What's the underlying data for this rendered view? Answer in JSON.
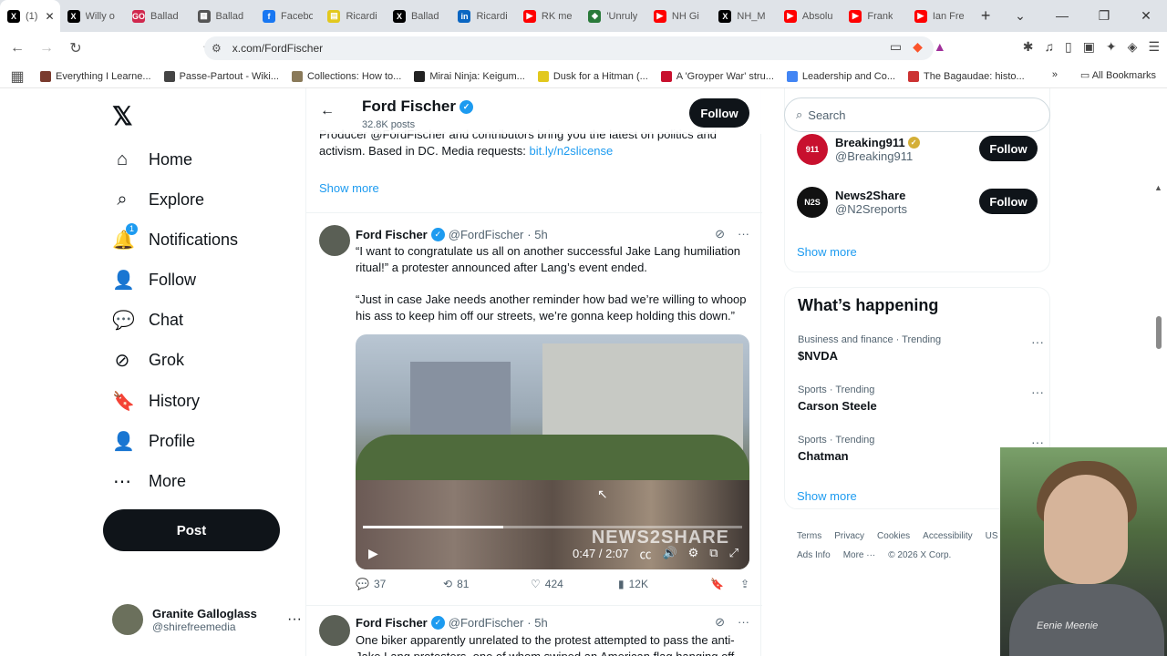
{
  "browser": {
    "tabs": [
      {
        "label": "(1)",
        "favicon": "X",
        "color": "#000000",
        "active": true
      },
      {
        "label": "Willy o",
        "favicon": "X",
        "color": "#000000"
      },
      {
        "label": "Ballad",
        "favicon": "GO",
        "color": "#d0284e"
      },
      {
        "label": "Ballad",
        "favicon": "▦",
        "color": "#555555"
      },
      {
        "label": "Facebo",
        "favicon": "f",
        "color": "#1877f2"
      },
      {
        "label": "Ricardi",
        "favicon": "▤",
        "color": "#e2c81e"
      },
      {
        "label": "Ballad",
        "favicon": "X",
        "color": "#000000"
      },
      {
        "label": "Ricardi",
        "favicon": "in",
        "color": "#0a66c2"
      },
      {
        "label": "RK me",
        "favicon": "▶",
        "color": "#ff0000"
      },
      {
        "label": "'Unruly",
        "favicon": "◆",
        "color": "#2a7a3a"
      },
      {
        "label": "NH Gi",
        "favicon": "▶",
        "color": "#ff0000"
      },
      {
        "label": "NH_M",
        "favicon": "X",
        "color": "#000000"
      },
      {
        "label": "Absolu",
        "favicon": "▶",
        "color": "#ff0000"
      },
      {
        "label": "Frank",
        "favicon": "▶",
        "color": "#ff0000"
      },
      {
        "label": "Ian Fre",
        "favicon": "▶",
        "color": "#ff0000"
      }
    ],
    "url": "x.com/FordFischer",
    "bookmarks": [
      {
        "label": "Everything I Learne...",
        "color": "#7a3b2e"
      },
      {
        "label": "Passe-Partout - Wiki...",
        "color": "#444444"
      },
      {
        "label": "Collections: How to...",
        "color": "#8a7a5a"
      },
      {
        "label": "Mirai Ninja: Keigum...",
        "color": "#222222"
      },
      {
        "label": "Dusk for a Hitman (...",
        "color": "#e2c81e"
      },
      {
        "label": "A 'Groyper War' stru...",
        "color": "#c8102e"
      },
      {
        "label": "Leadership and Co...",
        "color": "#4285f4"
      },
      {
        "label": "The Bagaudae: histo...",
        "color": "#cc3333"
      }
    ],
    "all_bookmarks": "All Bookmarks"
  },
  "nav": {
    "items": [
      {
        "label": "Home",
        "icon": "home-icon",
        "glyph": "⌂"
      },
      {
        "label": "Explore",
        "icon": "search-icon",
        "glyph": "⌕"
      },
      {
        "label": "Notifications",
        "icon": "bell-icon",
        "glyph": "🔔",
        "badge": "1"
      },
      {
        "label": "Follow",
        "icon": "person-plus-icon",
        "glyph": "👤"
      },
      {
        "label": "Chat",
        "icon": "chat-icon",
        "glyph": "💬"
      },
      {
        "label": "Grok",
        "icon": "grok-icon",
        "glyph": "⊘"
      },
      {
        "label": "History",
        "icon": "bookmark-icon",
        "glyph": "🔖"
      },
      {
        "label": "Profile",
        "icon": "profile-icon",
        "glyph": "👤"
      },
      {
        "label": "More",
        "icon": "more-circle-icon",
        "glyph": "⋯"
      }
    ],
    "post_label": "Post",
    "account": {
      "name": "Granite Galloglass",
      "handle": "@shirefreemedia"
    }
  },
  "profile": {
    "name": "Ford Fischer",
    "posts": "32.8K posts",
    "follow_label": "Follow",
    "bio_part1": "Producer @FordFischer and contributors bring you the latest on politics and activism. Based in DC. Media requests: ",
    "bio_link": "bit.ly/n2slicense",
    "show_more": "Show more"
  },
  "tweets": [
    {
      "name": "Ford Fischer",
      "handle": "@FordFischer",
      "time": "· 5h",
      "text1": "“I want to congratulate us all on another successful Jake Lang humiliation ritual!” a protester announced after Lang’s event ended.",
      "text2": "“Just in case Jake needs another reminder how bad we’re willing to whoop his ass to keep him off our streets, we’re gonna keep holding this down.”",
      "video": {
        "time": "0:47 / 2:07",
        "watermark": "NEWS2SHARE",
        "progress": 0.37
      },
      "replies": "37",
      "reposts": "81",
      "likes": "424",
      "views": "12K"
    },
    {
      "name": "Ford Fischer",
      "handle": "@FordFischer",
      "time": "· 5h",
      "text1": "One biker apparently unrelated to the protest attempted to pass the anti-Jake Lang protesters, one of whom swiped an American flag hanging off"
    }
  ],
  "sidebar": {
    "search_placeholder": "Search",
    "who_to_follow": [
      {
        "name": "Breaking911",
        "handle": "@Breaking911",
        "avatar": "911",
        "color": "#c8102e",
        "gold": true
      },
      {
        "name": "News2Share",
        "handle": "@N2Sreports",
        "avatar": "N2S",
        "color": "#111111",
        "gold": false
      }
    ],
    "follow_label": "Follow",
    "show_more": "Show more",
    "happening_title": "What’s happening",
    "trends": [
      {
        "meta": "Business and finance · Trending",
        "name": "$NVDA"
      },
      {
        "meta": "Sports · Trending",
        "name": "Carson Steele"
      },
      {
        "meta": "Sports · Trending",
        "name": "Chatman"
      }
    ],
    "trends_show_more": "Show more",
    "footer": [
      "Terms",
      "Privacy",
      "Cookies",
      "Accessibility",
      "US TIDA",
      "Ads Info",
      "More ···",
      "© 2026 X Corp."
    ]
  },
  "webcam": {
    "shirt_text": "Eenie Meenie"
  }
}
